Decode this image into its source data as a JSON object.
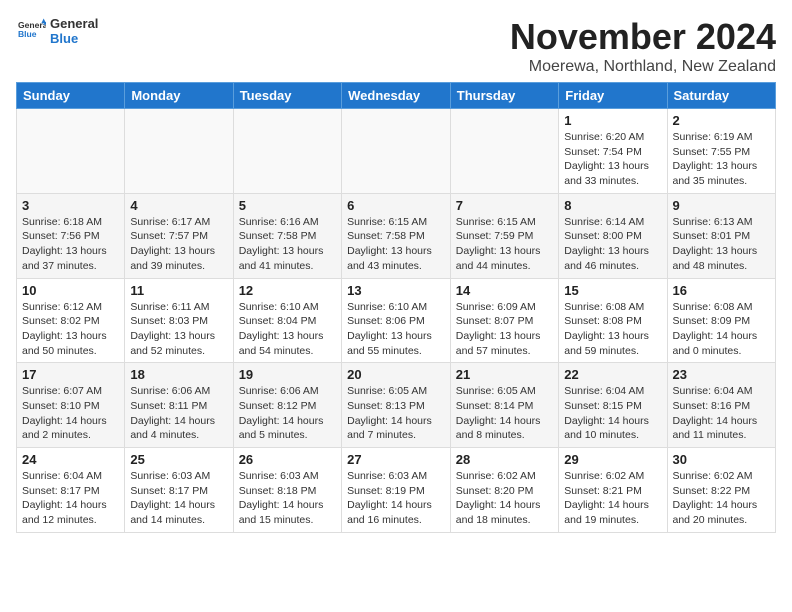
{
  "header": {
    "logo_general": "General",
    "logo_blue": "Blue",
    "title": "November 2024",
    "subtitle": "Moerewa, Northland, New Zealand"
  },
  "days_of_week": [
    "Sunday",
    "Monday",
    "Tuesday",
    "Wednesday",
    "Thursday",
    "Friday",
    "Saturday"
  ],
  "weeks": [
    [
      {
        "day": "",
        "info": ""
      },
      {
        "day": "",
        "info": ""
      },
      {
        "day": "",
        "info": ""
      },
      {
        "day": "",
        "info": ""
      },
      {
        "day": "",
        "info": ""
      },
      {
        "day": "1",
        "info": "Sunrise: 6:20 AM\nSunset: 7:54 PM\nDaylight: 13 hours and 33 minutes."
      },
      {
        "day": "2",
        "info": "Sunrise: 6:19 AM\nSunset: 7:55 PM\nDaylight: 13 hours and 35 minutes."
      }
    ],
    [
      {
        "day": "3",
        "info": "Sunrise: 6:18 AM\nSunset: 7:56 PM\nDaylight: 13 hours and 37 minutes."
      },
      {
        "day": "4",
        "info": "Sunrise: 6:17 AM\nSunset: 7:57 PM\nDaylight: 13 hours and 39 minutes."
      },
      {
        "day": "5",
        "info": "Sunrise: 6:16 AM\nSunset: 7:58 PM\nDaylight: 13 hours and 41 minutes."
      },
      {
        "day": "6",
        "info": "Sunrise: 6:15 AM\nSunset: 7:58 PM\nDaylight: 13 hours and 43 minutes."
      },
      {
        "day": "7",
        "info": "Sunrise: 6:15 AM\nSunset: 7:59 PM\nDaylight: 13 hours and 44 minutes."
      },
      {
        "day": "8",
        "info": "Sunrise: 6:14 AM\nSunset: 8:00 PM\nDaylight: 13 hours and 46 minutes."
      },
      {
        "day": "9",
        "info": "Sunrise: 6:13 AM\nSunset: 8:01 PM\nDaylight: 13 hours and 48 minutes."
      }
    ],
    [
      {
        "day": "10",
        "info": "Sunrise: 6:12 AM\nSunset: 8:02 PM\nDaylight: 13 hours and 50 minutes."
      },
      {
        "day": "11",
        "info": "Sunrise: 6:11 AM\nSunset: 8:03 PM\nDaylight: 13 hours and 52 minutes."
      },
      {
        "day": "12",
        "info": "Sunrise: 6:10 AM\nSunset: 8:04 PM\nDaylight: 13 hours and 54 minutes."
      },
      {
        "day": "13",
        "info": "Sunrise: 6:10 AM\nSunset: 8:06 PM\nDaylight: 13 hours and 55 minutes."
      },
      {
        "day": "14",
        "info": "Sunrise: 6:09 AM\nSunset: 8:07 PM\nDaylight: 13 hours and 57 minutes."
      },
      {
        "day": "15",
        "info": "Sunrise: 6:08 AM\nSunset: 8:08 PM\nDaylight: 13 hours and 59 minutes."
      },
      {
        "day": "16",
        "info": "Sunrise: 6:08 AM\nSunset: 8:09 PM\nDaylight: 14 hours and 0 minutes."
      }
    ],
    [
      {
        "day": "17",
        "info": "Sunrise: 6:07 AM\nSunset: 8:10 PM\nDaylight: 14 hours and 2 minutes."
      },
      {
        "day": "18",
        "info": "Sunrise: 6:06 AM\nSunset: 8:11 PM\nDaylight: 14 hours and 4 minutes."
      },
      {
        "day": "19",
        "info": "Sunrise: 6:06 AM\nSunset: 8:12 PM\nDaylight: 14 hours and 5 minutes."
      },
      {
        "day": "20",
        "info": "Sunrise: 6:05 AM\nSunset: 8:13 PM\nDaylight: 14 hours and 7 minutes."
      },
      {
        "day": "21",
        "info": "Sunrise: 6:05 AM\nSunset: 8:14 PM\nDaylight: 14 hours and 8 minutes."
      },
      {
        "day": "22",
        "info": "Sunrise: 6:04 AM\nSunset: 8:15 PM\nDaylight: 14 hours and 10 minutes."
      },
      {
        "day": "23",
        "info": "Sunrise: 6:04 AM\nSunset: 8:16 PM\nDaylight: 14 hours and 11 minutes."
      }
    ],
    [
      {
        "day": "24",
        "info": "Sunrise: 6:04 AM\nSunset: 8:17 PM\nDaylight: 14 hours and 12 minutes."
      },
      {
        "day": "25",
        "info": "Sunrise: 6:03 AM\nSunset: 8:17 PM\nDaylight: 14 hours and 14 minutes."
      },
      {
        "day": "26",
        "info": "Sunrise: 6:03 AM\nSunset: 8:18 PM\nDaylight: 14 hours and 15 minutes."
      },
      {
        "day": "27",
        "info": "Sunrise: 6:03 AM\nSunset: 8:19 PM\nDaylight: 14 hours and 16 minutes."
      },
      {
        "day": "28",
        "info": "Sunrise: 6:02 AM\nSunset: 8:20 PM\nDaylight: 14 hours and 18 minutes."
      },
      {
        "day": "29",
        "info": "Sunrise: 6:02 AM\nSunset: 8:21 PM\nDaylight: 14 hours and 19 minutes."
      },
      {
        "day": "30",
        "info": "Sunrise: 6:02 AM\nSunset: 8:22 PM\nDaylight: 14 hours and 20 minutes."
      }
    ]
  ]
}
